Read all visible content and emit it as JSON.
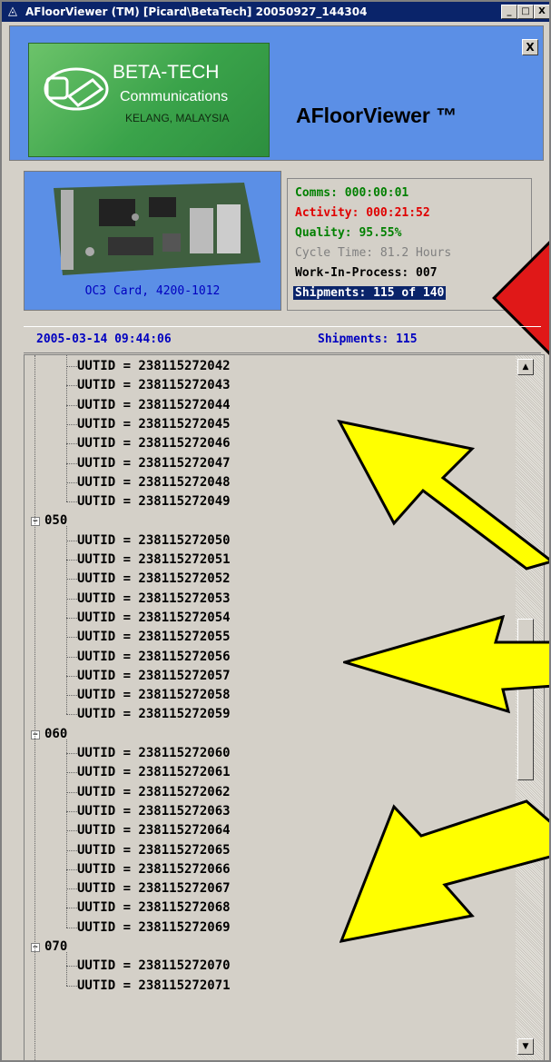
{
  "window": {
    "title": "AFloorViewer (TM)  [Picard\\BetaTech]  20050927_144304",
    "min_label": "_",
    "max_label": "□",
    "close_label": "X"
  },
  "header": {
    "logo_line1": "BETA-TECH",
    "logo_line2": "Communications",
    "logo_line3": "KELANG, MALAYSIA",
    "app_name": "AFloorViewer ™",
    "close_label": "X"
  },
  "card": {
    "caption": "OC3 Card, 4200-1012"
  },
  "stats": {
    "comms": "Comms: 000:00:01",
    "activity": "Activity: 000:21:52",
    "quality": "Quality:  95.55%",
    "cycle_time": "Cycle Time: 81.2 Hours",
    "wip": "Work-In-Process: 007",
    "shipments": "Shipments: 115 of 140"
  },
  "status": {
    "timestamp": "2005-03-14 09:44:06",
    "shipments": "Shipments: 115"
  },
  "tree": {
    "prefix": "UUTID = ",
    "groups": [
      {
        "label": "",
        "ids": [
          "238115272042",
          "238115272043",
          "238115272044",
          "238115272045",
          "238115272046",
          "238115272047",
          "238115272048",
          "238115272049"
        ]
      },
      {
        "label": "050",
        "ids": [
          "238115272050",
          "238115272051",
          "238115272052",
          "238115272053",
          "238115272054",
          "238115272055",
          "238115272056",
          "238115272057",
          "238115272058",
          "238115272059"
        ]
      },
      {
        "label": "060",
        "ids": [
          "238115272060",
          "238115272061",
          "238115272062",
          "238115272063",
          "238115272064",
          "238115272065",
          "238115272066",
          "238115272067",
          "238115272068",
          "238115272069"
        ]
      },
      {
        "label": "070",
        "ids": [
          "238115272070",
          "238115272071"
        ]
      }
    ]
  },
  "colors": {
    "green": "#008000",
    "red": "#e00000",
    "gray": "#808080",
    "blue": "#0000c0",
    "selection": "#0a246a",
    "arrow": "#ffff00"
  }
}
